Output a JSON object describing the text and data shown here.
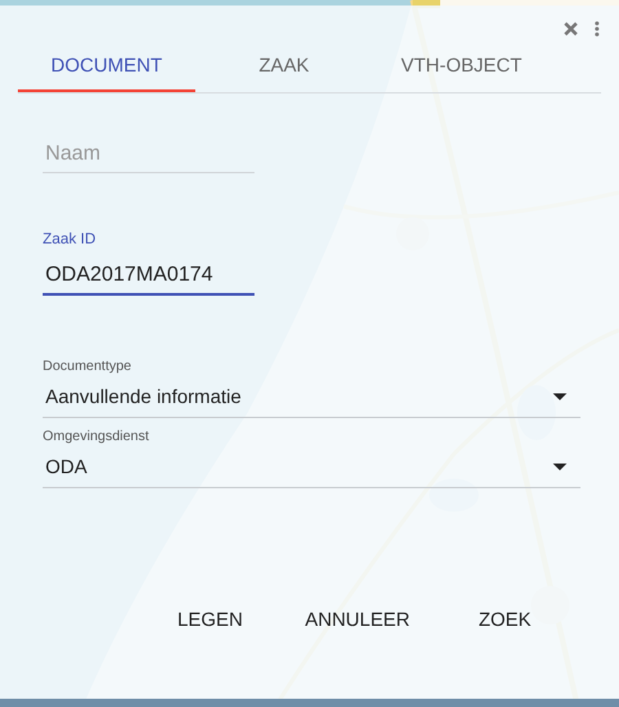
{
  "tabs": [
    {
      "label": "DOCUMENT",
      "selected": true
    },
    {
      "label": "ZAAK",
      "selected": false
    },
    {
      "label": "VTH-OBJECT",
      "selected": false
    }
  ],
  "fields": [
    {
      "placeholder": "Naam",
      "focused": false
    },
    {
      "label": "Zaak ID",
      "value": "ODA2017MA0174",
      "focused": true
    }
  ],
  "selects": [
    {
      "label": "Documenttype",
      "value": "Aanvullende informatie"
    },
    {
      "label": "Omgevingsdienst",
      "value": "ODA"
    }
  ],
  "buttons": [
    "LEGEN",
    "ANNULEER",
    "ZOEK"
  ]
}
